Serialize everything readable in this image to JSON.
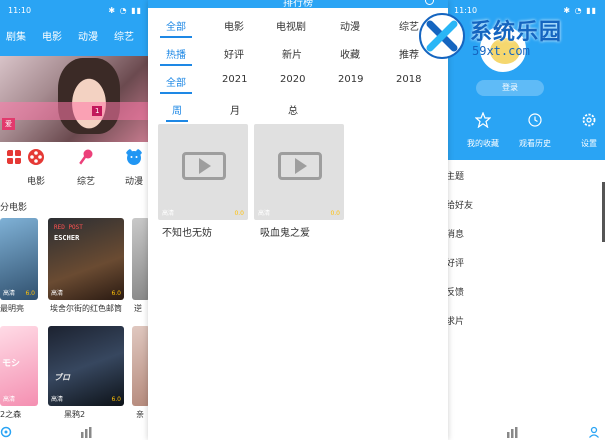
{
  "status_time": "11:10",
  "left": {
    "nav_tabs": [
      "剧集",
      "电影",
      "动漫",
      "综艺"
    ],
    "categories": [
      "",
      "电影",
      "综艺",
      "动漫"
    ],
    "section_title": "分电影",
    "poster2_line1": "RED POST",
    "poster2_line2": "ESCHER",
    "movies": [
      "最明亮",
      "埃舍尔街的红色邮筒",
      "逆",
      "2之森",
      "黑鸦2",
      "亲"
    ],
    "poster_tag": "高清",
    "scores": [
      "6.0",
      "6.0"
    ]
  },
  "center": {
    "title": "排行榜",
    "row1": [
      "全部",
      "电影",
      "电视剧",
      "动漫",
      "综艺"
    ],
    "row2": [
      "热播",
      "好评",
      "新片",
      "收藏",
      "推荐"
    ],
    "row3": [
      "全部",
      "2021",
      "2020",
      "2019",
      "2018"
    ],
    "row4": [
      "周",
      "月",
      "总"
    ],
    "videos": [
      {
        "quality": "高清",
        "score": "0.0",
        "name": "不知也无妨"
      },
      {
        "quality": "高清",
        "score": "0.0",
        "name": "吸血鬼之爱"
      }
    ]
  },
  "right": {
    "login": "登录",
    "shortcuts": [
      "我的收藏",
      "观看历史",
      "设置"
    ],
    "menu": [
      "主题",
      "给好友",
      "消息",
      "好评",
      "反馈",
      "求片"
    ]
  },
  "watermark": {
    "brand": "系统乐园",
    "url": "59xt.com"
  },
  "colors": {
    "primary": "#2aa4f4",
    "accent": "#1e88e5",
    "score": "#ffc107"
  }
}
